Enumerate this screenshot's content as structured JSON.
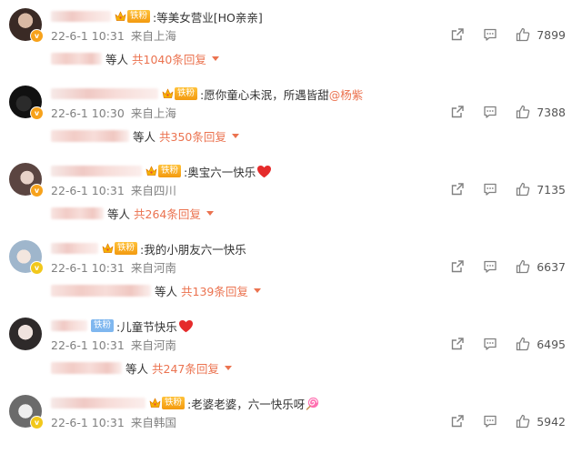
{
  "colors": {
    "accent": "#eb7350",
    "vip_orange": "#f7a21b",
    "vip_gold": "#f2c81b",
    "fan_gold": "#f39a0f",
    "fan_blue": "#7fb7ef",
    "meta_gray": "#808080"
  },
  "reply_suffix": "等人",
  "comments": [
    {
      "fan_badge": "铁粉",
      "text": ":等美女营业[HO亲亲]",
      "mention": "",
      "emoji": "",
      "date": "22-6-1 10:31",
      "location": "来自上海",
      "likes": "7899",
      "reply_total": "共1040条回复",
      "verified": "orange"
    },
    {
      "fan_badge": "铁粉",
      "text": ":愿你童心未泯，所遇皆甜",
      "mention": "@杨紫",
      "emoji": "",
      "date": "22-6-1 10:30",
      "location": "来自上海",
      "likes": "7388",
      "reply_total": "共350条回复",
      "verified": "orange"
    },
    {
      "fan_badge": "铁粉",
      "text": ":奥宝六一快乐",
      "mention": "",
      "emoji": "heart-icon",
      "date": "22-6-1 10:31",
      "location": "来自四川",
      "likes": "7135",
      "reply_total": "共264条回复",
      "verified": "orange"
    },
    {
      "fan_badge": "铁粉",
      "text": ":我的小朋友六一快乐",
      "mention": "",
      "emoji": "",
      "date": "22-6-1 10:31",
      "location": "来自河南",
      "likes": "6637",
      "reply_total": "共139条回复",
      "verified": "gold"
    },
    {
      "fan_badge": "铁粉",
      "text": ":儿童节快乐",
      "mention": "",
      "emoji": "heart-icon",
      "date": "22-6-1 10:31",
      "location": "来自河南",
      "likes": "6495",
      "reply_total": "共247条回复",
      "verified": "none"
    },
    {
      "fan_badge": "铁粉",
      "text": ":老婆老婆，六一快乐呀",
      "mention": "",
      "emoji": "lollipop-icon",
      "date": "22-6-1 10:31",
      "location": "来自韩国",
      "likes": "5942",
      "reply_total": "",
      "verified": "gold"
    }
  ]
}
